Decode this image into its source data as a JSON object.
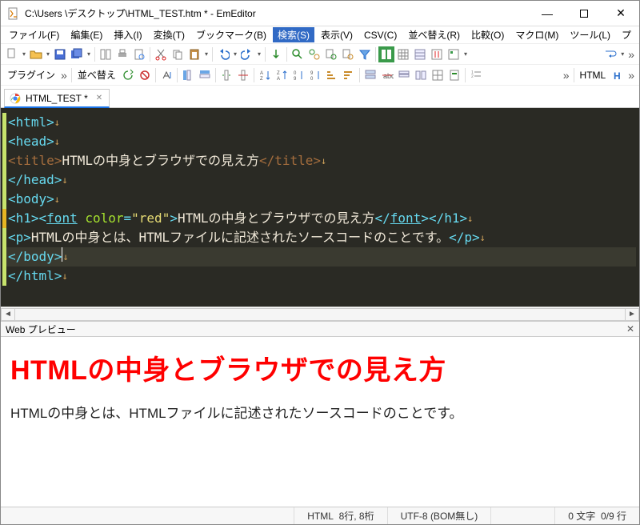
{
  "window": {
    "title": "C:\\Users                    \\デスクトップ\\HTML_TEST.htm * - EmEditor"
  },
  "menu": {
    "file": "ファイル(F)",
    "edit": "編集(E)",
    "insert": "挿入(I)",
    "convert": "変換(T)",
    "bookmark": "ブックマーク(B)",
    "search": "検索(S)",
    "view": "表示(V)",
    "csv": "CSV(C)",
    "sort": "並べ替え(R)",
    "compare": "比較(O)",
    "macro": "マクロ(M)",
    "tools": "ツール(L)",
    "plus": "プ"
  },
  "toolbar2": {
    "plugins": "プラグイン",
    "sort": "並べ替え",
    "html": "HTML"
  },
  "tab": {
    "label": "HTML_TEST *"
  },
  "code": {
    "l1_tag": "<html>",
    "l2_tag": "<head>",
    "l3_open": "<title>",
    "l3_text": "HTMLの中身とブラウザでの見え方",
    "l3_close": "</title>",
    "l4_tag": "</head>",
    "l5_tag": "<body>",
    "l6_h1o": "<h1>",
    "l6_fonto": "<font",
    "l6_sp": " ",
    "l6_attr": "color",
    "l6_eq": "=",
    "l6_val": "\"red\"",
    "l6_gt": ">",
    "l6_text": "HTMLの中身とブラウザでの見え方",
    "l6_fontc": "</font>",
    "l6_h1c": "</h1>",
    "l7_po": "<p>",
    "l7_text": "HTMLの中身とは、HTMLファイルに記述されたソースコードのことです。",
    "l7_pc": "</p>",
    "l8_tag": "</body>",
    "l9_tag": "</html>",
    "ret": "↓"
  },
  "preview_panel": {
    "title": "Web プレビュー",
    "h1": "HTMLの中身とブラウザでの見え方",
    "p": "HTMLの中身とは、HTMLファイルに記述されたソースコードのことです。"
  },
  "status": {
    "lang": "HTML",
    "pos": "8行, 8桁",
    "enc": "UTF-8 (BOM無し)",
    "sel": "0 文字",
    "lines": "0/9 行"
  }
}
